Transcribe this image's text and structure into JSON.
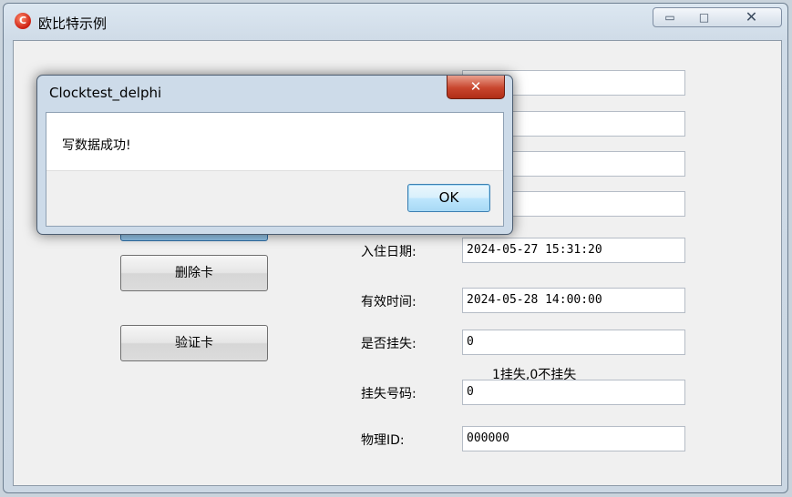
{
  "window": {
    "title": "欧比特示例",
    "icon": "app-logo-icon",
    "controls": {
      "minimize": "▭",
      "maximize": "□",
      "close": "✕"
    }
  },
  "buttons": {
    "delete_card": "删除卡",
    "verify_card": "验证卡"
  },
  "form": {
    "checkin_date": {
      "label": "入住日期:",
      "value": "2024-05-27 15:31:20"
    },
    "valid_time": {
      "label": "有效时间:",
      "value": "2024-05-28 14:00:00"
    },
    "is_lost": {
      "label": "是否挂失:",
      "value": "0"
    },
    "lost_hint": "1挂失,0不挂失",
    "lost_number": {
      "label": "挂失号码:",
      "value": "0"
    },
    "physical_id": {
      "label": "物理ID:",
      "value": "000000"
    }
  },
  "dialog": {
    "title": "Clocktest_delphi",
    "message": "写数据成功!",
    "ok_label": "OK",
    "close_glyph": "✕"
  }
}
